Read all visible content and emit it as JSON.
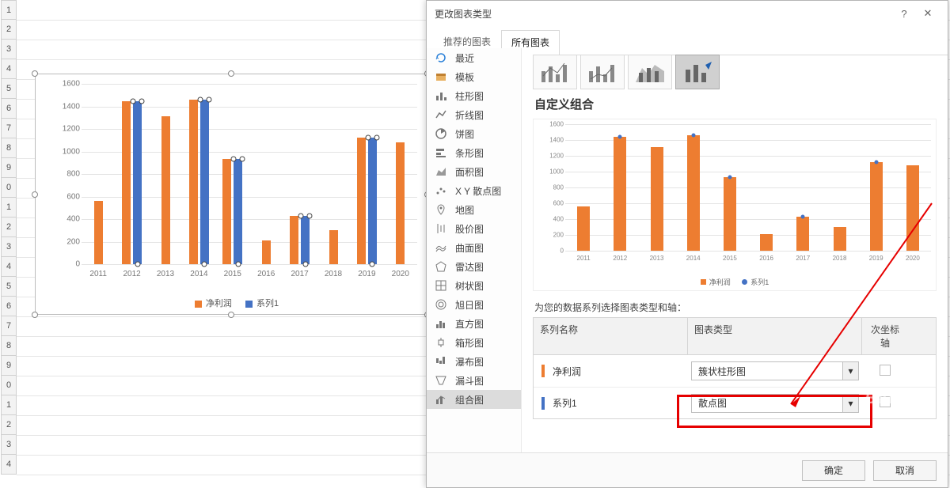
{
  "rows": [
    "1",
    "2",
    "3",
    "4",
    "5",
    "6",
    "7",
    "8",
    "9",
    "0",
    "1",
    "2",
    "3",
    "4",
    "5",
    "6",
    "7",
    "8",
    "9",
    "0",
    "1",
    "2",
    "3",
    "4"
  ],
  "dialog": {
    "title": "更改图表类型",
    "help": "?",
    "tabs": {
      "recommended": "推荐的图表",
      "all": "所有图表"
    },
    "preview_title": "自定义组合",
    "series_instruction": "为您的数据系列选择图表类型和轴：",
    "headers": {
      "name": "系列名称",
      "type": "图表类型",
      "axis": "次坐标轴"
    },
    "rows": [
      {
        "name": "净利润",
        "type": "簇状柱形图",
        "color": "#ed7d31"
      },
      {
        "name": "系列1",
        "type": "散点图",
        "color": "#4472c4"
      }
    ],
    "ok": "确定",
    "cancel": "取消"
  },
  "categories": [
    {
      "key": "recent",
      "label": "最近"
    },
    {
      "key": "template",
      "label": "模板"
    },
    {
      "key": "column",
      "label": "柱形图"
    },
    {
      "key": "line",
      "label": "折线图"
    },
    {
      "key": "pie",
      "label": "饼图"
    },
    {
      "key": "bar",
      "label": "条形图"
    },
    {
      "key": "area",
      "label": "面积图"
    },
    {
      "key": "xy",
      "label": "X Y 散点图"
    },
    {
      "key": "map",
      "label": "地图"
    },
    {
      "key": "stock",
      "label": "股价图"
    },
    {
      "key": "surface",
      "label": "曲面图"
    },
    {
      "key": "radar",
      "label": "雷达图"
    },
    {
      "key": "treemap",
      "label": "树状图"
    },
    {
      "key": "sunburst",
      "label": "旭日图"
    },
    {
      "key": "histogram",
      "label": "直方图"
    },
    {
      "key": "box",
      "label": "箱形图"
    },
    {
      "key": "waterfall",
      "label": "瀑布图"
    },
    {
      "key": "funnel",
      "label": "漏斗图"
    },
    {
      "key": "combo",
      "label": "组合图"
    }
  ],
  "legend": {
    "s1": "净利润",
    "s2": "系列1"
  },
  "chart_data": [
    {
      "type": "bar",
      "location": "worksheet-main",
      "title": "",
      "categories": [
        "2011",
        "2012",
        "2013",
        "2014",
        "2015",
        "2016",
        "2017",
        "2018",
        "2019",
        "2020"
      ],
      "series": [
        {
          "name": "净利润",
          "color": "#ed7d31",
          "values": [
            565,
            1444,
            1313,
            1457,
            930,
            214,
            427,
            305,
            1122,
            1078
          ]
        },
        {
          "name": "系列1",
          "color": "#4472c4",
          "values": [
            null,
            1444,
            null,
            1457,
            930,
            null,
            427,
            null,
            1122,
            null
          ]
        }
      ],
      "ylabel": "",
      "xlabel": "",
      "ylim": [
        0,
        1600
      ],
      "ystep": 200
    },
    {
      "type": "combo",
      "location": "dialog-preview",
      "title": "自定义组合",
      "categories": [
        "2011",
        "2012",
        "2013",
        "2014",
        "2015",
        "2016",
        "2017",
        "2018",
        "2019",
        "2020"
      ],
      "series": [
        {
          "name": "净利润",
          "kind": "bar",
          "color": "#ed7d31",
          "values": [
            565,
            1444,
            1313,
            1457,
            930,
            214,
            427,
            305,
            1122,
            1078
          ]
        },
        {
          "name": "系列1",
          "kind": "scatter",
          "color": "#4472c4",
          "values": [
            null,
            1444,
            null,
            1457,
            930,
            null,
            427,
            null,
            1122,
            null
          ]
        }
      ],
      "ylabel": "",
      "xlabel": "",
      "ylim": [
        0,
        1600
      ],
      "ystep": 200
    }
  ]
}
